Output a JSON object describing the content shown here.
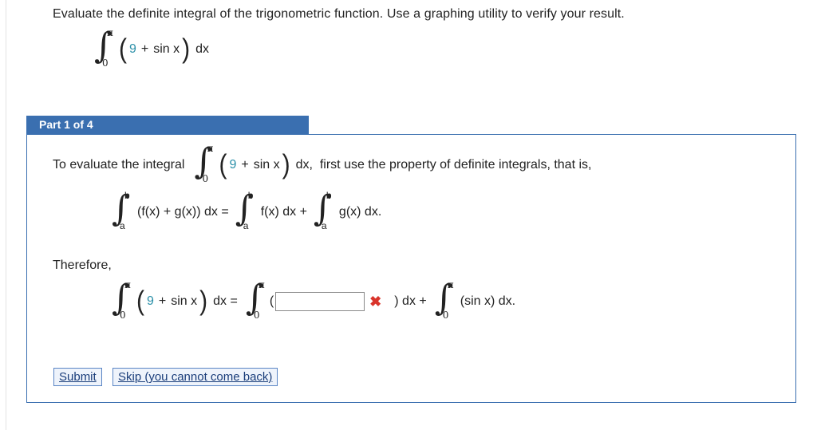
{
  "prompt": "Evaluate the definite integral of the trigonometric function. Use a graphing utility to verify your result.",
  "integral": {
    "upper": "π",
    "lower": "0",
    "const": "9",
    "plus": "+",
    "func": "sin x",
    "dx": "dx"
  },
  "part_label": "Part 1 of 4",
  "instruction": {
    "lead": "To evaluate the integral",
    "tail": "dx,  first use the property of definite integrals, that is,"
  },
  "property": {
    "upper": "b",
    "lower": "a",
    "lhs": "(f(x) + g(x)) dx =",
    "term1": "f(x) dx +",
    "term2": "g(x) dx."
  },
  "therefore": "Therefore,",
  "answer": {
    "eq": "dx =",
    "open_paren": "(",
    "input_value": "",
    "status_icon": "✖",
    "after_input": ") dx +",
    "sin_term": "(sin x) dx."
  },
  "buttons": {
    "submit": "Submit",
    "skip": "Skip (you cannot come back)"
  }
}
